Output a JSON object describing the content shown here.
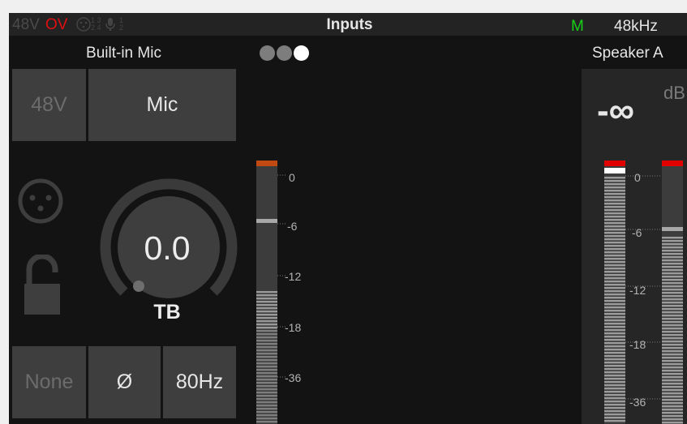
{
  "topbar": {
    "phantom": "48V",
    "overload": "OV",
    "mic_icon": "mic-input-icon",
    "mic_ratio_top": "1 3",
    "mic_ratio_bottom": "2 4",
    "phantom_icon": "microphone-icon",
    "phantom_ratio_top": "1",
    "phantom_ratio_bottom": "2",
    "title": "Inputs",
    "monitor_flag": "M",
    "sample_rate": "48kHz"
  },
  "channel": {
    "name": "Built-in Mic",
    "phantom_button": "48V",
    "type_button": "Mic",
    "connector_icon": "xlr-connector-icon",
    "lock_icon": "unlocked-padlock-icon",
    "gain_value": "0.0",
    "gain_label": "TB",
    "gain_level": 0.0,
    "filter_button": "None",
    "phase_button": "Ø",
    "highpass_button": "80Hz"
  },
  "pager": {
    "count": 3,
    "active_index": 2
  },
  "input_meter": {
    "scale": [
      "0",
      "-6",
      "-12",
      "-18",
      "-36"
    ],
    "peak_color": "#c04a12",
    "hold_db": -6
  },
  "output": {
    "name": "Speaker A",
    "level": "-∞",
    "unit": "dB",
    "scale": [
      "0",
      "-6",
      "-12",
      "-18",
      "-36"
    ],
    "clip_color": "#e00000"
  }
}
